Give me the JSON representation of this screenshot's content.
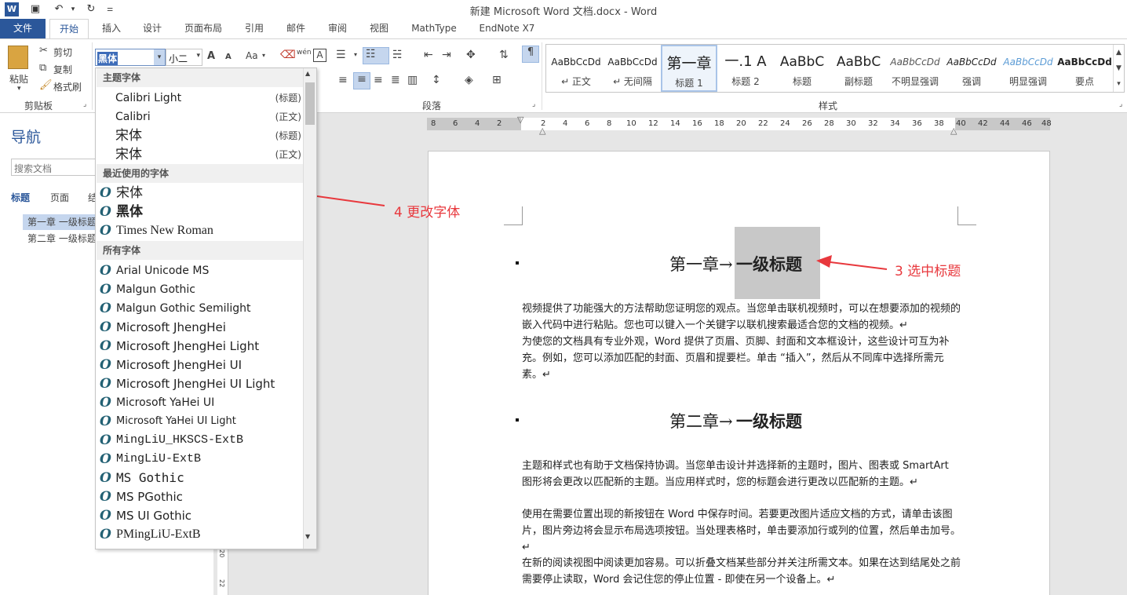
{
  "window": {
    "title": "新建 Microsoft Word 文档.docx - Word"
  },
  "quick_access": {
    "save": "save-icon",
    "undo": "undo-icon",
    "redo": "redo-icon",
    "customize": "customize-icon"
  },
  "tabs": [
    {
      "label": "文件"
    },
    {
      "label": "开始"
    },
    {
      "label": "插入"
    },
    {
      "label": "设计"
    },
    {
      "label": "页面布局"
    },
    {
      "label": "引用"
    },
    {
      "label": "邮件"
    },
    {
      "label": "审阅"
    },
    {
      "label": "视图"
    },
    {
      "label": "MathType"
    },
    {
      "label": "EndNote X7"
    }
  ],
  "clipboard": {
    "paste": "粘贴",
    "cut": "剪切",
    "copy": "复制",
    "format_painter": "格式刷",
    "group": "剪贴板"
  },
  "font": {
    "name_value": "黑体",
    "size_value": "小二",
    "grow": "A",
    "shrink": "A",
    "case": "Aa",
    "phonetic": "wén",
    "border_char": "A"
  },
  "paragraph": {
    "group": "段落"
  },
  "styles": {
    "group": "样式",
    "items": [
      {
        "sample": "AaBbCcDd",
        "name": "↵ 正文"
      },
      {
        "sample": "AaBbCcDd",
        "name": "↵ 无间隔"
      },
      {
        "sample": "第一章",
        "name": "标题 1"
      },
      {
        "sample": "一.1 A",
        "name": "标题 2"
      },
      {
        "sample": "AaBbC",
        "name": "标题"
      },
      {
        "sample": "AaBbC",
        "name": "副标题"
      },
      {
        "sample": "AaBbCcDd",
        "name": "不明显强调"
      },
      {
        "sample": "AaBbCcDd",
        "name": "强调"
      },
      {
        "sample": "AaBbCcDd",
        "name": "明显强调"
      },
      {
        "sample": "AaBbCcDd",
        "name": "要点"
      }
    ]
  },
  "nav": {
    "title": "导航",
    "search_placeholder": "搜索文档",
    "tabs": [
      "标题",
      "页面",
      "结"
    ],
    "headings": [
      "第一章 一级标题",
      "第二章 一级标题"
    ]
  },
  "ruler": {
    "ticks": [
      "8",
      "6",
      "4",
      "2",
      "2",
      "4",
      "6",
      "8",
      "10",
      "12",
      "14",
      "16",
      "18",
      "20",
      "22",
      "24",
      "26",
      "28",
      "30",
      "32",
      "34",
      "36",
      "38",
      "40",
      "42",
      "44",
      "46",
      "48"
    ]
  },
  "vruler": {
    "ticks": [
      "20",
      "22"
    ]
  },
  "dropdown": {
    "theme_section": "主题字体",
    "theme_fonts": [
      {
        "name": "Calibri Light",
        "tag": "(标题)"
      },
      {
        "name": "Calibri",
        "tag": "(正文)"
      },
      {
        "name": "宋体",
        "tag": "(标题)"
      },
      {
        "name": "宋体",
        "tag": "(正文)"
      }
    ],
    "recent_section": "最近使用的字体",
    "recent_fonts": [
      "宋体",
      "黑体",
      "Times New Roman"
    ],
    "all_section": "所有字体",
    "all_fonts": [
      "Arial Unicode MS",
      "Malgun Gothic",
      "Malgun Gothic Semilight",
      "Microsoft JhengHei",
      "Microsoft JhengHei Light",
      "Microsoft JhengHei UI",
      "Microsoft JhengHei UI Light",
      "Microsoft YaHei UI",
      "Microsoft YaHei UI Light",
      "MingLiU_HKSCS-ExtB",
      "MingLiU-ExtB",
      "MS Gothic",
      "MS PGothic",
      "MS UI Gothic",
      "PMingLiU-ExtB"
    ]
  },
  "document": {
    "h1_prefix": "第一章→",
    "h1_main": "一级标题",
    "p1": "视频提供了功能强大的方法帮助您证明您的观点。当您单击联机视频时，可以在想要添加的视频的嵌入代码中进行粘贴。您也可以键入一个关键字以联机搜索最适合您的文档的视频。↵",
    "p2": "为使您的文档具有专业外观，Word 提供了页眉、页脚、封面和文本框设计，这些设计可互为补充。例如，您可以添加匹配的封面、页眉和提要栏。单击 “插入”，然后从不同库中选择所需元素。↵",
    "h2_prefix": "第二章→",
    "h2_main": "一级标题",
    "p3": "主题和样式也有助于文档保持协调。当您单击设计并选择新的主题时，图片、图表或 SmartArt 图形将会更改以匹配新的主题。当应用样式时，您的标题会进行更改以匹配新的主题。↵",
    "p4": "使用在需要位置出现的新按钮在 Word 中保存时间。若要更改图片适应文档的方式，请单击该图片，图片旁边将会显示布局选项按钮。当处理表格时，单击要添加行或列的位置，然后单击加号。↵",
    "p5": "在新的阅读视图中阅读更加容易。可以折叠文档某些部分并关注所需文本。如果在达到结尾处之前需要停止读取，Word 会记住您的停止位置 - 即使在另一个设备上。↵"
  },
  "annotations": {
    "a4": "4 更改字体",
    "a3": "3 选中标题"
  },
  "colors": {
    "accent": "#2b579a",
    "annotation": "#e8383d"
  }
}
